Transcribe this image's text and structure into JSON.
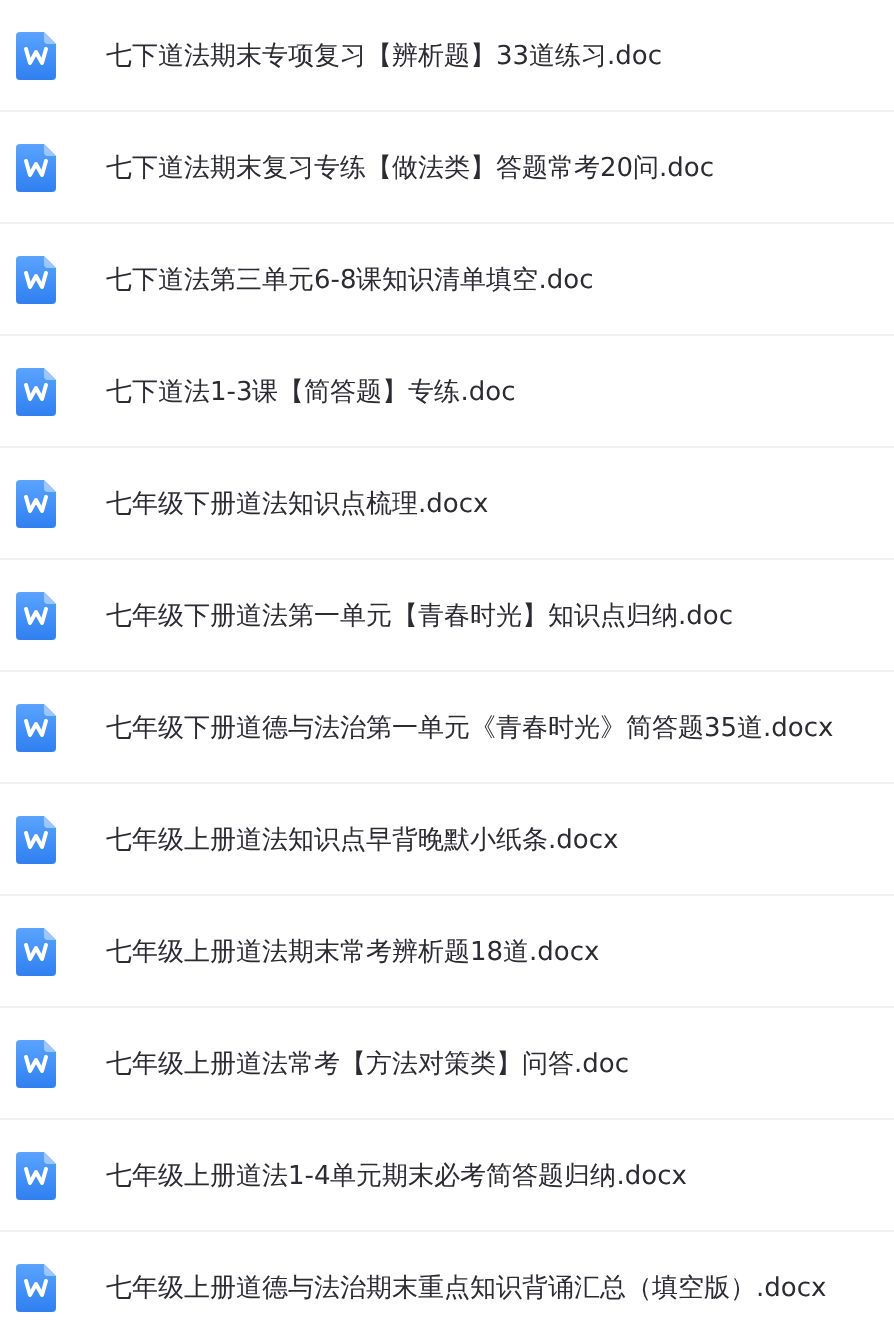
{
  "files": [
    {
      "name": "七下道法期末专项复习【辨析题】33道练习.doc"
    },
    {
      "name": "七下道法期末复习专练【做法类】答题常考20问.doc"
    },
    {
      "name": "七下道法第三单元6-8课知识清单填空.doc"
    },
    {
      "name": "七下道法1-3课【简答题】专练.doc"
    },
    {
      "name": "七年级下册道法知识点梳理.docx"
    },
    {
      "name": "七年级下册道法第一单元【青春时光】知识点归纳.doc"
    },
    {
      "name": "七年级下册道德与法治第一单元《青春时光》简答题35道.docx"
    },
    {
      "name": "七年级上册道法知识点早背晚默小纸条.docx"
    },
    {
      "name": "七年级上册道法期末常考辨析题18道.docx"
    },
    {
      "name": "七年级上册道法常考【方法对策类】问答.doc"
    },
    {
      "name": "七年级上册道法1-4单元期末必考简答题归纳.docx"
    },
    {
      "name": "七年级上册道德与法治期末重点知识背诵汇总（填空版）.docx"
    }
  ]
}
